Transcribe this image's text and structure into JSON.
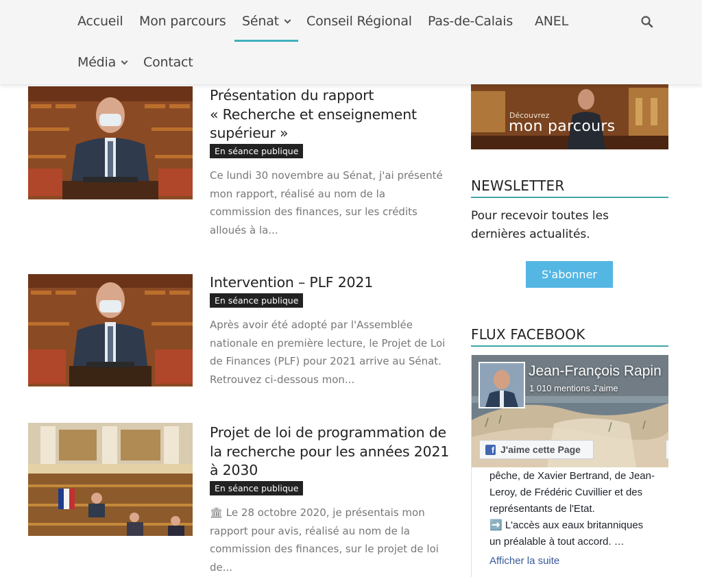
{
  "nav": {
    "items": [
      {
        "label": "Accueil"
      },
      {
        "label": "Mon parcours"
      },
      {
        "label": "Sénat"
      },
      {
        "label": "Conseil Régional"
      },
      {
        "label": "Pas-de-Calais"
      },
      {
        "label": "ANEL"
      },
      {
        "label": "Média"
      },
      {
        "label": "Contact"
      }
    ],
    "active": "Sénat",
    "accent_color": "#3fb0bd"
  },
  "posts": [
    {
      "title_lines": [
        "Présentation du rapport",
        "« Recherche et enseignement",
        "supérieur »"
      ],
      "tag": "En séance publique",
      "excerpt_lines": [
        "Ce lundi 30 novembre au Sénat, j'ai présenté",
        "mon rapport, réalisé au nom de la",
        "commission des finances, sur les crédits",
        "alloués à la..."
      ]
    },
    {
      "title_lines": [
        "Intervention – PLF 2021"
      ],
      "tag": "En séance publique",
      "excerpt_lines": [
        "Après avoir été adopté par l'Assemblée",
        "nationale en première lecture, le Projet de Loi",
        "de Finances (PLF) pour 2021 arrive au Sénat.",
        "Retrouvez ci-dessous mon..."
      ]
    },
    {
      "title_lines": [
        "Projet de loi de programmation de",
        "la recherche pour les années 2021",
        "à 2030"
      ],
      "tag": "En séance publique",
      "excerpt_lines": [
        "🏛 Le 28 octobre 2020, je présentais mon",
        "rapport pour avis, réalisé au nom de la",
        "commission des finances, sur le projet de loi",
        "de..."
      ]
    }
  ],
  "sidebar": {
    "banner": {
      "small": "Découvrez",
      "big": "mon parcours"
    },
    "newsletter": {
      "title": "NEWSLETTER",
      "text_lines": [
        "Pour recevoir toutes les",
        "dernières actualités."
      ],
      "button": "S'abonner",
      "button_color": "#54b6e3"
    },
    "facebook": {
      "title": "FLUX FACEBOOK",
      "page_name": "Jean-François Rapin",
      "likes": "1 010 mentions J'aime",
      "like_button": "J'aime cette Page",
      "post_lines": [
        "pêche, de Xavier Bertrand, de Jean-",
        "Leroy, de Frédéric Cuvillier et des",
        "représentants de l'Etat.",
        "➡️ L'accès aux eaux britanniques",
        "un préalable à tout accord. …"
      ],
      "more": "Afficher la suite",
      "link_color": "#385898"
    }
  }
}
